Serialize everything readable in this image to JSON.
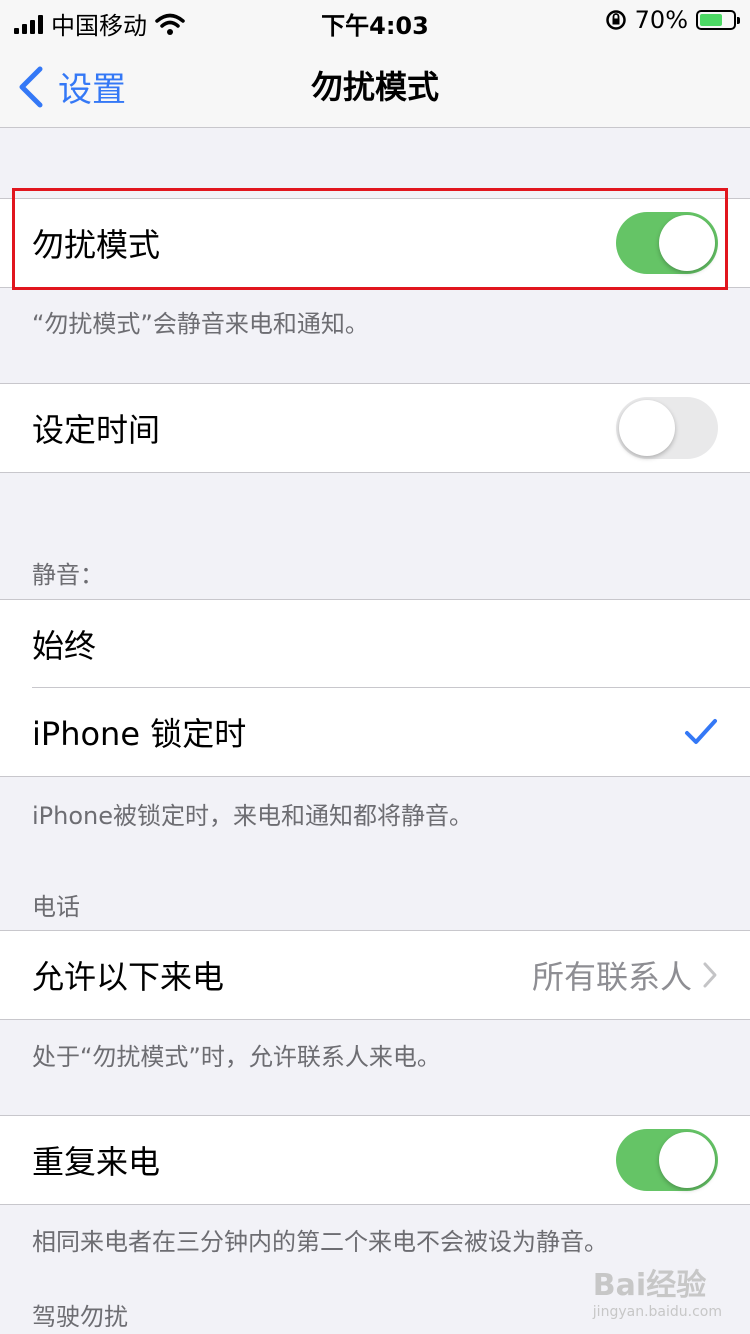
{
  "status_bar": {
    "carrier": "中国移动",
    "time": "下午4:03",
    "battery": "70%",
    "battery_level": 0.7
  },
  "nav": {
    "back_label": "设置",
    "title": "勿扰模式"
  },
  "dnd": {
    "label": "勿扰模式",
    "toggle_on": true,
    "footer": "“勿扰模式”会静音来电和通知。"
  },
  "scheduled": {
    "label": "设定时间",
    "toggle_on": false
  },
  "silence": {
    "header": "静音：",
    "options": [
      {
        "label": "始终",
        "selected": false
      },
      {
        "label": "iPhone 锁定时",
        "selected": true
      }
    ],
    "footer": "iPhone被锁定时，来电和通知都将静音。"
  },
  "phone": {
    "header": "电话",
    "allow_calls_label": "允许以下来电",
    "allow_calls_value": "所有联系人",
    "footer": "处于“勿扰模式”时，允许联系人来电。"
  },
  "repeated": {
    "label": "重复来电",
    "toggle_on": true,
    "footer": "相同来电者在三分钟内的第二个来电不会被设为静音。"
  },
  "driving": {
    "header": "驾驶勿扰"
  },
  "watermark": {
    "text": "Bai经验",
    "sub": "jingyan.baidu.com"
  },
  "colors": {
    "accent": "#3478f6",
    "toggle_on": "#65c466",
    "highlight": "#e1161e"
  }
}
